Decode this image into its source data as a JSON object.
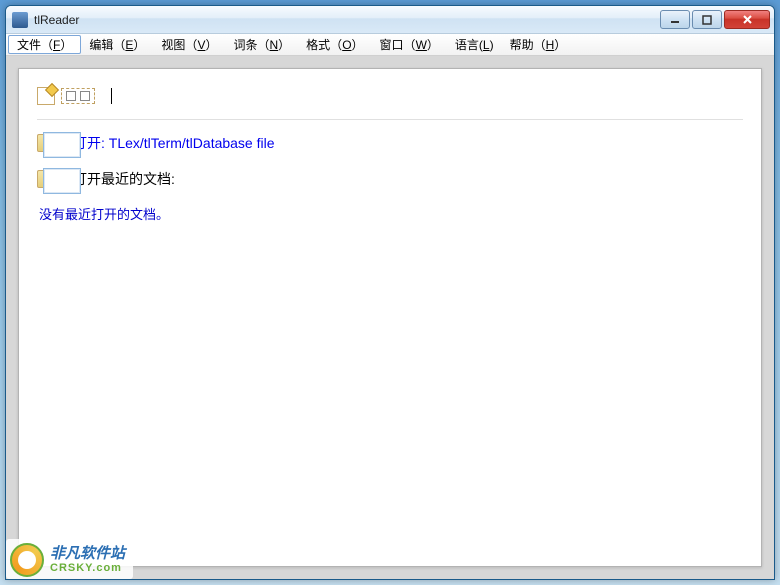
{
  "window": {
    "title": "tlReader"
  },
  "menubar": {
    "items": [
      {
        "pre": "文件（",
        "hot": "F",
        "post": "）"
      },
      {
        "pre": "编辑（",
        "hot": "E",
        "post": "）"
      },
      {
        "pre": "视图（",
        "hot": "V",
        "post": "）"
      },
      {
        "pre": "词条（",
        "hot": "N",
        "post": "）"
      },
      {
        "pre": "格式（",
        "hot": "O",
        "post": "）"
      },
      {
        "pre": "窗口（",
        "hot": "W",
        "post": "）"
      },
      {
        "pre": "语言(",
        "hot": "L",
        "post": ")"
      },
      {
        "pre": "帮助（",
        "hot": "H",
        "post": "）"
      }
    ]
  },
  "content": {
    "open_link": "打开: TLex/tlTerm/tlDatabase file",
    "recent_heading": "打开最近的文档:",
    "no_recent": "没有最近打开的文档。"
  },
  "watermark": {
    "main": "非凡软件站",
    "sub": "CRSKY.com"
  }
}
